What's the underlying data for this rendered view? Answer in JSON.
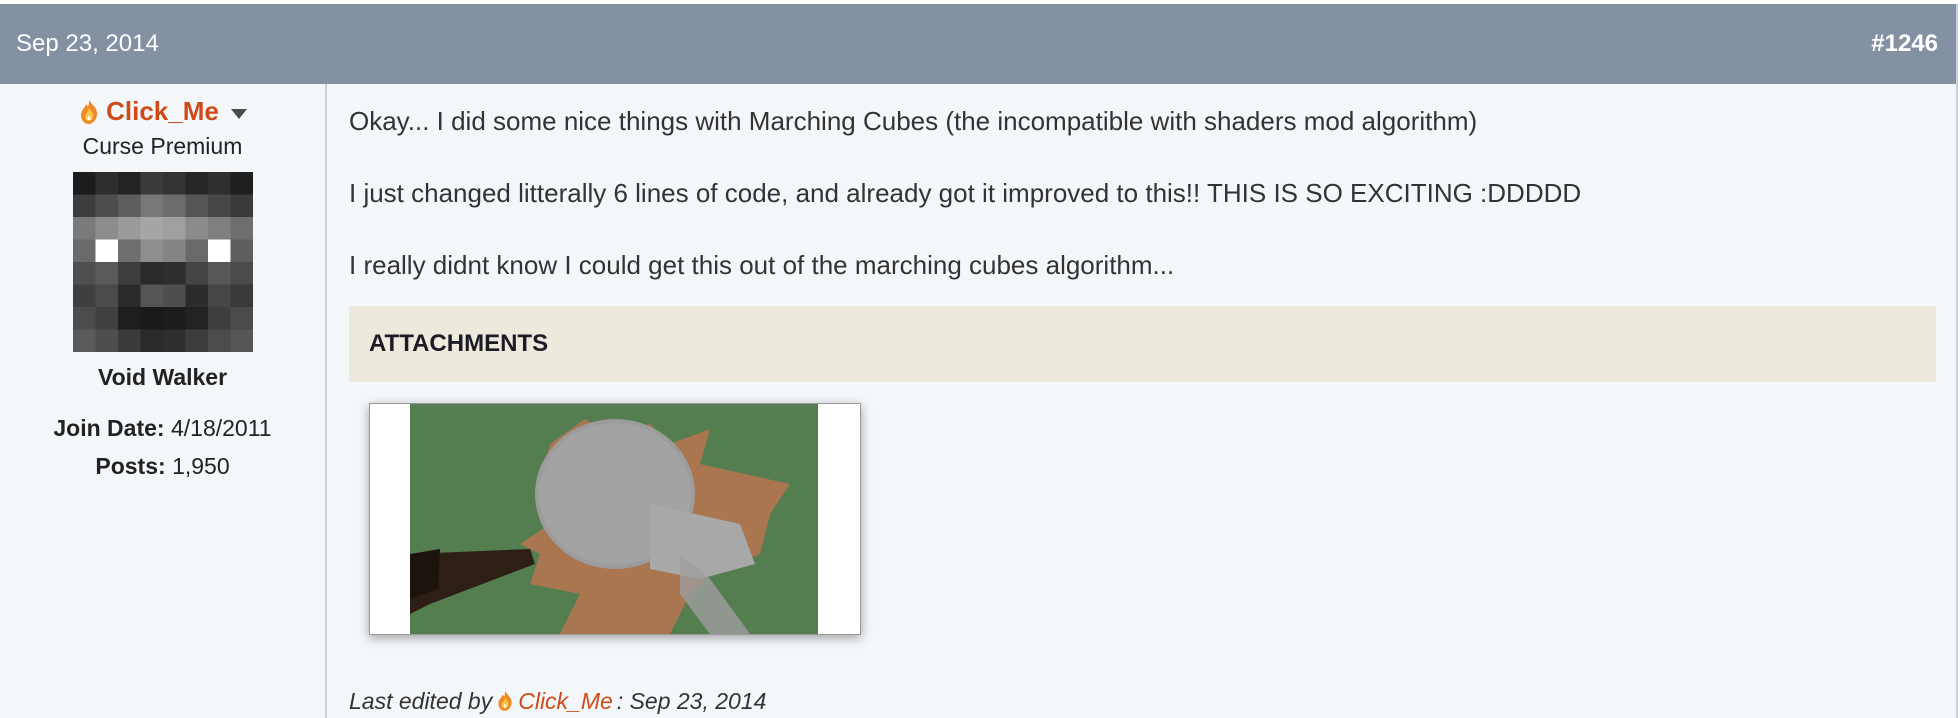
{
  "post": {
    "date": "Sep 23, 2014",
    "number": "#1246"
  },
  "user": {
    "name": "Click_Me",
    "title": "Curse Premium",
    "rank": "Void Walker",
    "join_date_label": "Join Date:",
    "join_date": "4/18/2011",
    "posts_label": "Posts:",
    "posts": "1,950",
    "name_color": "#cf4a17"
  },
  "message": {
    "lines": [
      "Okay... I did some nice things with Marching Cubes (the incompatible with shaders mod algorithm)",
      "I just changed litterally 6 lines of code, and already got it improved to this!! THIS IS SO EXCITING :DDDDD",
      "I really didnt know I could get this out of the marching cubes algorithm..."
    ]
  },
  "attachments": {
    "title": "ATTACHMENTS"
  },
  "edit": {
    "prefix": "Last edited by",
    "editor": "Click_Me",
    "date": ": Sep 23, 2014"
  },
  "colors": {
    "header_bg": "#8391a3",
    "post_bg": "#f4f7fa",
    "attach_bg": "#ede9dc",
    "accent": "#cf4a17"
  }
}
